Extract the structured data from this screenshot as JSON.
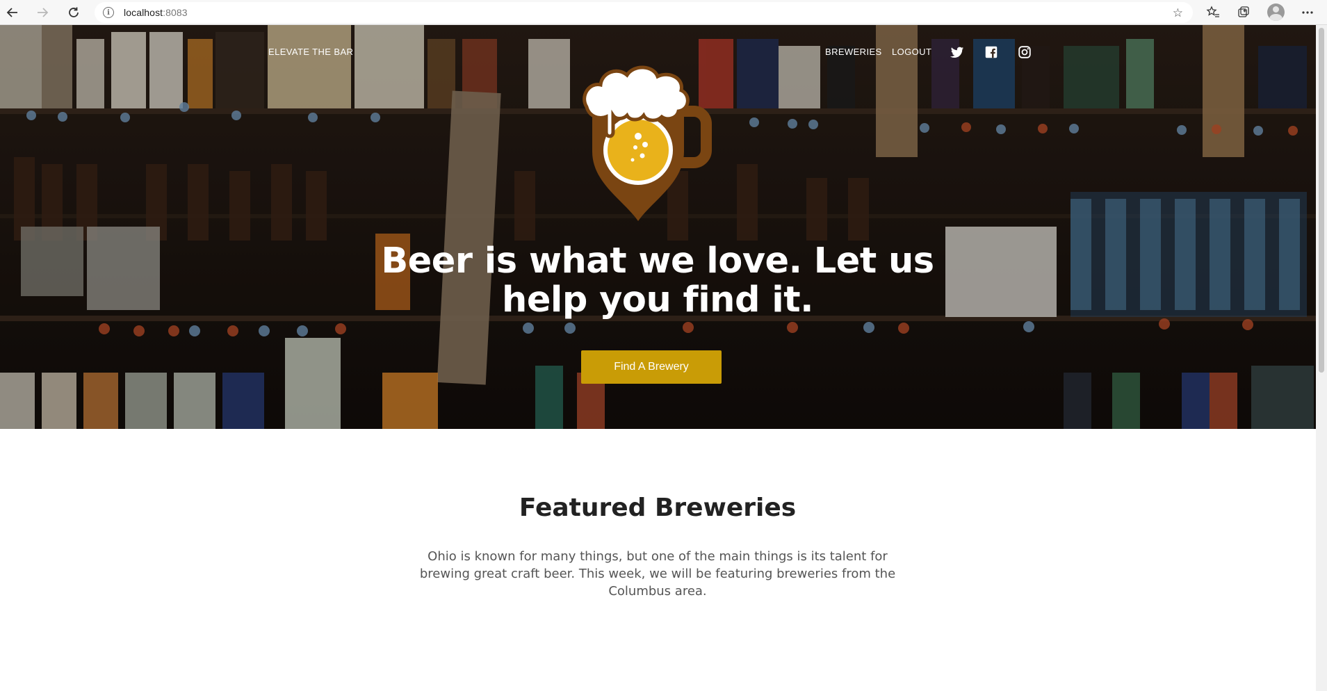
{
  "browser": {
    "url_host": "localhost",
    "url_port": ":8083",
    "back_icon": "arrow-left-icon",
    "forward_icon": "arrow-right-icon",
    "reload_icon": "reload-icon"
  },
  "nav": {
    "brand": "ELEVATE THE BAR",
    "links": [
      "BREWERIES",
      "LOGOUT"
    ],
    "social": [
      "twitter-icon",
      "facebook-icon",
      "instagram-icon"
    ]
  },
  "hero": {
    "title": "Beer is what we love. Let us help you find it.",
    "cta": "Find A Brewery",
    "accent": "#c99c06",
    "logo_colors": {
      "mug": "#7a4512",
      "beer": "#e9b21b",
      "foam": "#ffffff"
    }
  },
  "featured": {
    "title": "Featured Breweries",
    "body": "Ohio is known for many things, but one of the main things is its talent for brewing great craft beer. This week, we will be featuring breweries from the Columbus area."
  }
}
